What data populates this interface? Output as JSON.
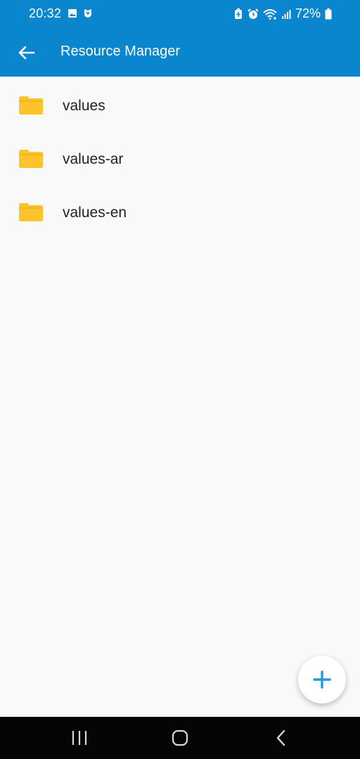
{
  "status_bar": {
    "time": "20:32",
    "battery": "72%",
    "icons": [
      "image-icon",
      "shield-app-icon",
      "battery-saver-icon",
      "alarm-icon",
      "wifi-icon",
      "signal-icon",
      "battery-icon"
    ]
  },
  "app_bar": {
    "title": "Resource Manager",
    "back_icon": "arrow-left-icon"
  },
  "folders": [
    {
      "name": "values"
    },
    {
      "name": "values-ar"
    },
    {
      "name": "values-en"
    }
  ],
  "fab": {
    "icon": "plus-icon"
  },
  "nav_bar": {
    "icons": [
      "recents-icon",
      "home-icon",
      "back-icon"
    ]
  },
  "colors": {
    "primary": "#0a86cf",
    "folder": "#fcc32a",
    "fab_icon": "#1e9ae0",
    "background": "#f9f9f9"
  }
}
